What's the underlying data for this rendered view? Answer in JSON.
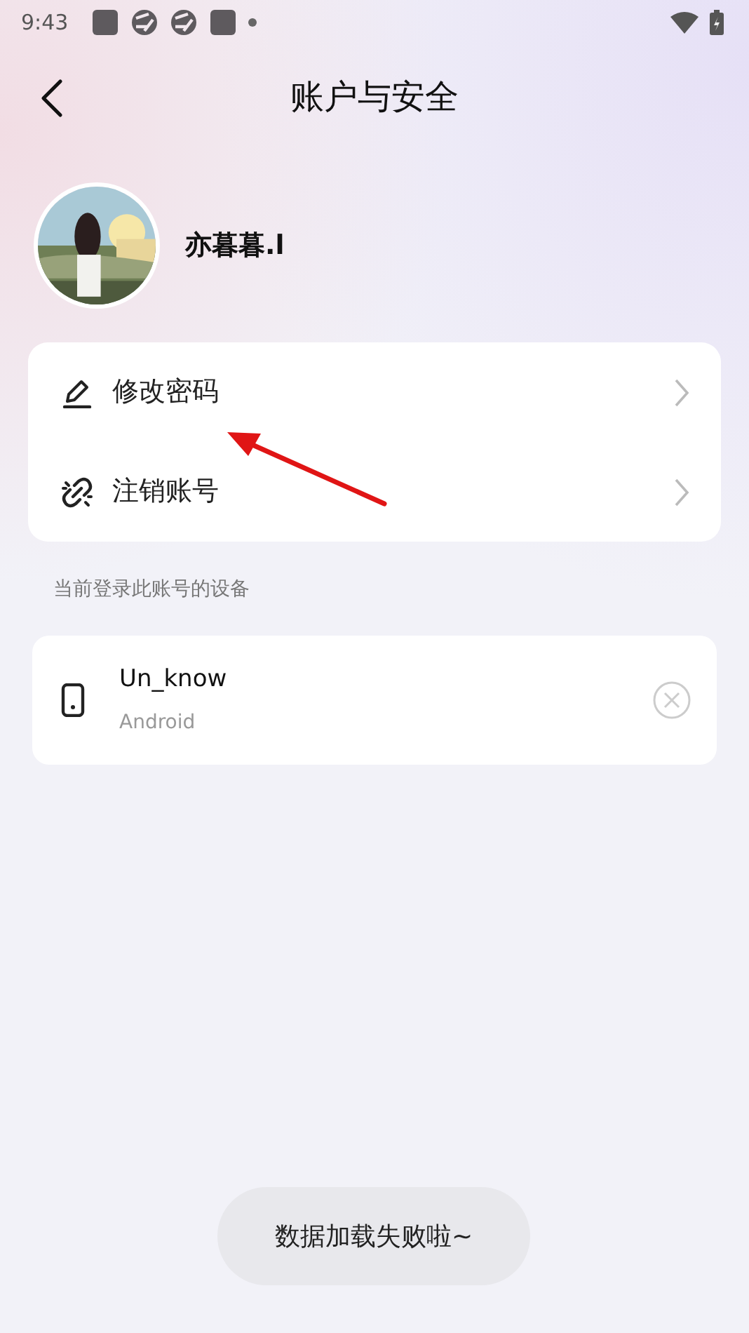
{
  "status_bar": {
    "time": "9:43",
    "notifications": [
      {
        "kind": "square"
      },
      {
        "kind": "aperture"
      },
      {
        "kind": "aperture"
      },
      {
        "kind": "square"
      },
      {
        "kind": "dot"
      }
    ]
  },
  "header": {
    "title": "账户与安全"
  },
  "profile": {
    "name": "亦暮暮.l"
  },
  "menu": [
    {
      "kind": "edit",
      "label": "修改密码"
    },
    {
      "kind": "unlink",
      "label": "注销账号"
    }
  ],
  "devices_section": {
    "label": "当前登录此账号的设备",
    "devices": [
      {
        "name": "Un_know",
        "platform": "Android"
      }
    ]
  },
  "toast": "数据加载失败啦~"
}
